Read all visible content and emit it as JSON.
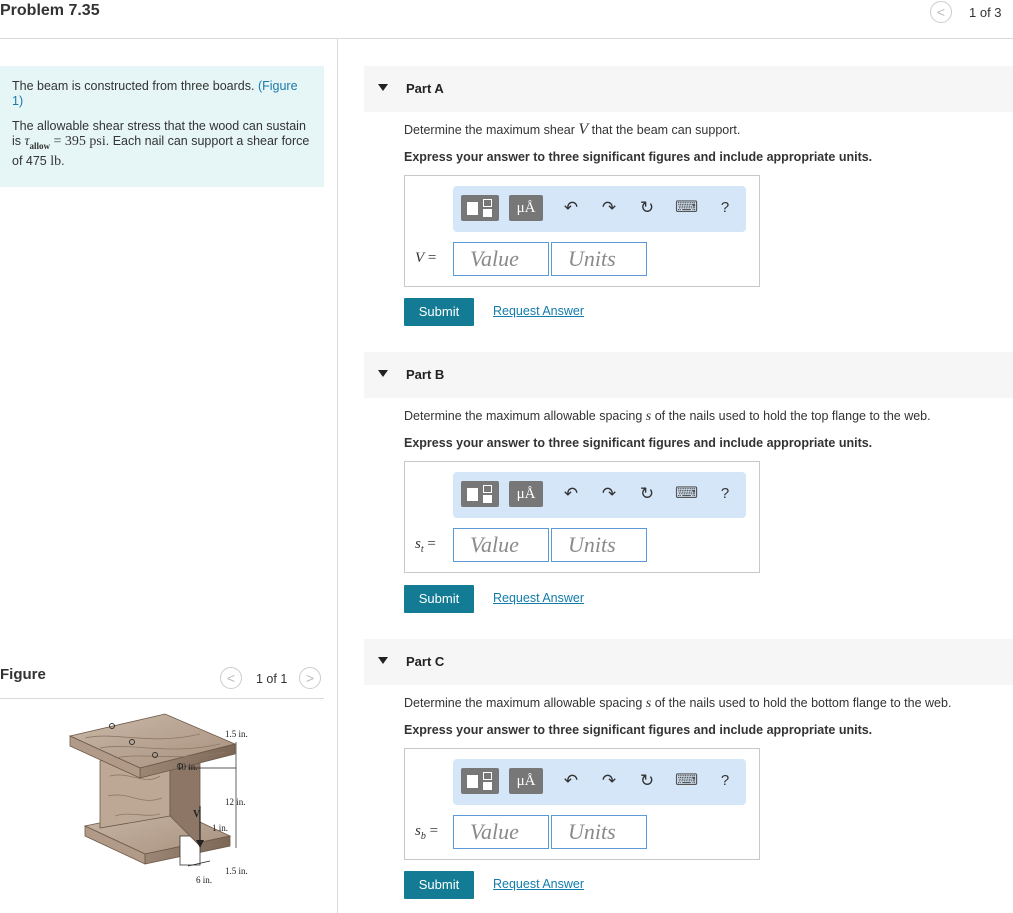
{
  "header": {
    "title": "Problem 7.35",
    "page_indicator": "1 of 3",
    "prev_glyph": "<"
  },
  "intro": {
    "line1_text": "The beam is constructed from three boards. ",
    "figure_link": "(Figure 1)",
    "line2_pre": "The allowable shear stress that the wood can sustain is ",
    "tau_symbol": "τ",
    "tau_sub": "allow",
    "tau_value": " = 395 psi",
    "line2_post": ". Each nail can support a shear force of 475 ",
    "force_unit": "lb",
    "period": "."
  },
  "figure": {
    "title": "Figure",
    "page_indicator": "1 of 1",
    "prev_glyph": "<",
    "next_glyph": ">",
    "labels": {
      "top_thickness": "1.5 in.",
      "top_width": "10 in.",
      "web_height": "12 in.",
      "web_thickness": "1 in.",
      "bottom_thickness": "1.5 in.",
      "bottom_width": "6 in.",
      "shear": "V"
    }
  },
  "toolbar_glyphs": {
    "units": "μÅ",
    "undo": "↶",
    "redo": "↷",
    "reset": "↻",
    "keyboard": "⌨",
    "help": "?"
  },
  "parts": [
    {
      "label": "Part A",
      "question_pre": "Determine the maximum shear ",
      "question_var": "V",
      "question_post": " that the beam can support.",
      "instruction": "Express your answer to three significant figures and include appropriate units.",
      "eq_var": "V",
      "eq_sub": "",
      "eq_sign": " =",
      "value_placeholder": "Value",
      "units_placeholder": "Units",
      "submit": "Submit",
      "request": "Request Answer"
    },
    {
      "label": "Part B",
      "question_pre": "Determine the maximum allowable spacing ",
      "question_var": "s",
      "question_post": " of the nails used to hold the top flange to the web.",
      "instruction": "Express your answer to three significant figures and include appropriate units.",
      "eq_var": "s",
      "eq_sub": "t",
      "eq_sign": " =",
      "value_placeholder": "Value",
      "units_placeholder": "Units",
      "submit": "Submit",
      "request": "Request Answer"
    },
    {
      "label": "Part C",
      "question_pre": "Determine the maximum allowable spacing ",
      "question_var": "s",
      "question_post": " of the nails used to hold the bottom flange to the web.",
      "instruction": "Express your answer to three significant figures and include appropriate units.",
      "eq_var": "s",
      "eq_sub": "b",
      "eq_sign": " =",
      "value_placeholder": "Value",
      "units_placeholder": "Units",
      "submit": "Submit",
      "request": "Request Answer"
    }
  ]
}
